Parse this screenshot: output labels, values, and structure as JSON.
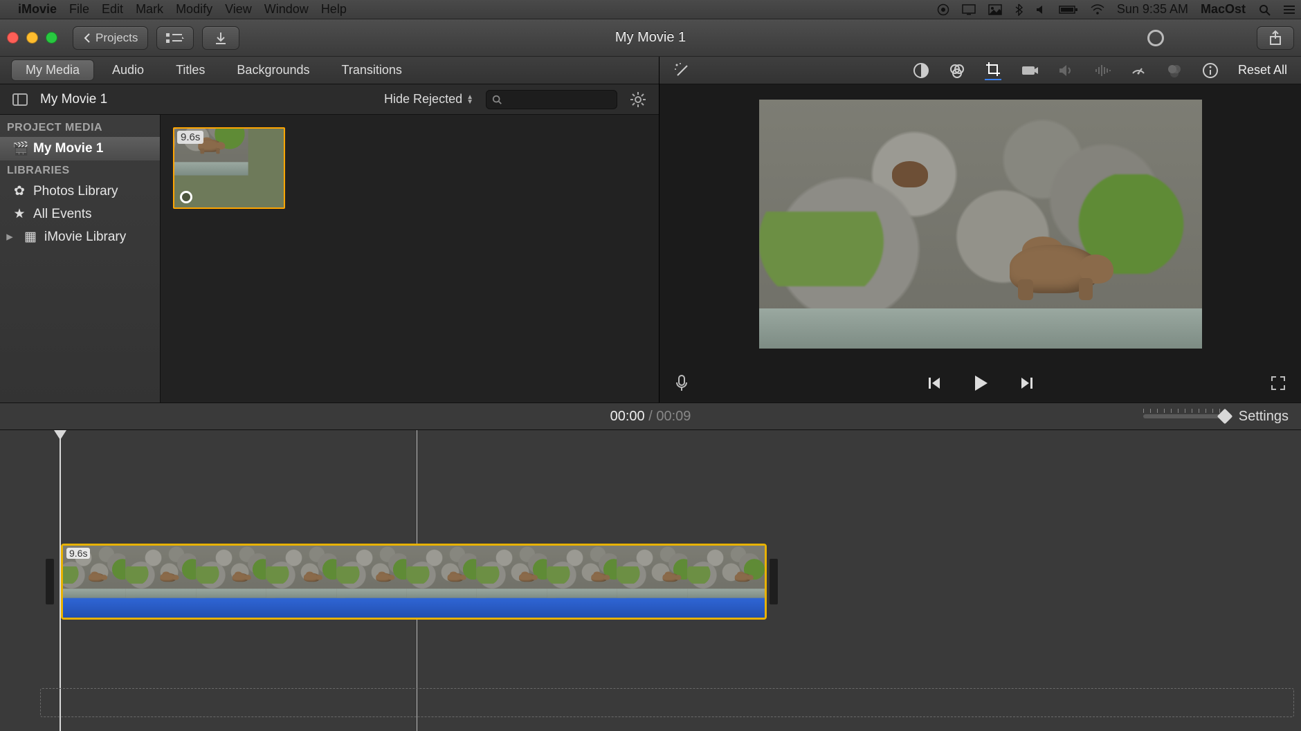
{
  "menubar": {
    "app": "iMovie",
    "items": [
      "File",
      "Edit",
      "Mark",
      "Modify",
      "View",
      "Window",
      "Help"
    ],
    "clock": "Sun 9:35 AM",
    "user": "MacOst"
  },
  "titlebar": {
    "back_label": "Projects",
    "title": "My Movie 1"
  },
  "tabs": {
    "items": [
      "My Media",
      "Audio",
      "Titles",
      "Backgrounds",
      "Transitions"
    ],
    "active": 0
  },
  "media_header": {
    "project_name": "My Movie 1",
    "filter_label": "Hide Rejected",
    "search_placeholder": ""
  },
  "sidebar": {
    "section1": "PROJECT MEDIA",
    "project": "My Movie 1",
    "section2": "LIBRARIES",
    "items": [
      {
        "icon": "photos",
        "label": "Photos Library"
      },
      {
        "icon": "events",
        "label": "All Events"
      },
      {
        "icon": "imovie",
        "label": "iMovie Library"
      }
    ]
  },
  "browser": {
    "clip_duration": "9.6s"
  },
  "adjust": {
    "reset": "Reset All"
  },
  "transport": {
    "current": "00:00",
    "sep": " / ",
    "total": "00:09"
  },
  "timeline": {
    "clip_duration": "9.6s",
    "settings_label": "Settings"
  }
}
